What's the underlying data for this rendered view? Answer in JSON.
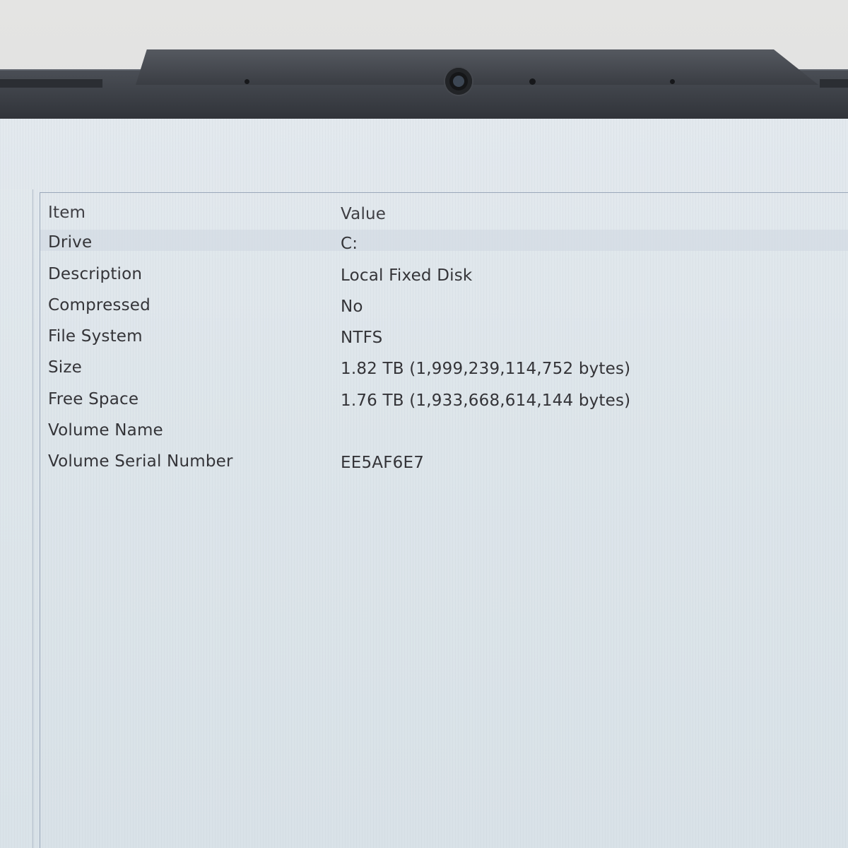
{
  "table": {
    "headers": {
      "item": "Item",
      "value": "Value"
    },
    "rows": [
      {
        "item": "Drive",
        "value": "C:"
      },
      {
        "item": "Description",
        "value": "Local Fixed Disk"
      },
      {
        "item": "Compressed",
        "value": "No"
      },
      {
        "item": "File System",
        "value": "NTFS"
      },
      {
        "item": "Size",
        "value": "1.82 TB (1,999,239,114,752 bytes)"
      },
      {
        "item": "Free Space",
        "value": "1.76 TB (1,933,668,614,144 bytes)"
      },
      {
        "item": "Volume Name",
        "value": ""
      },
      {
        "item": "Volume Serial Number",
        "value": "EE5AF6E7"
      }
    ]
  }
}
